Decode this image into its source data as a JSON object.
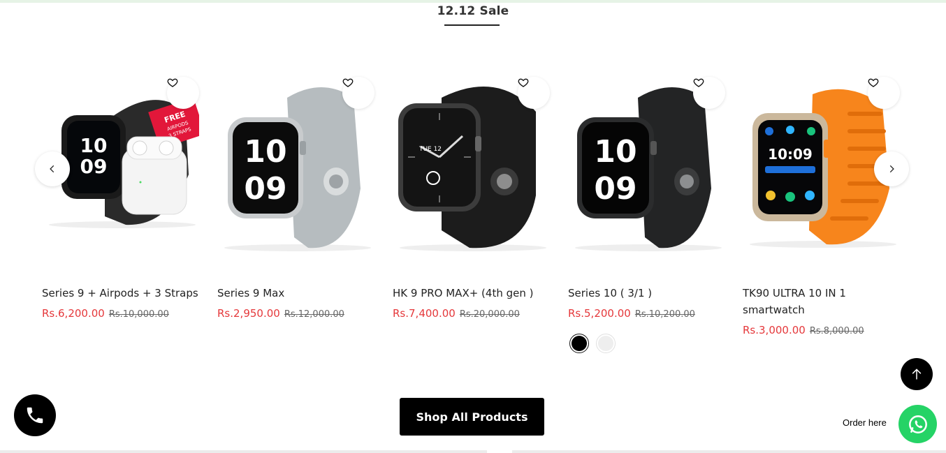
{
  "section": {
    "title": "12.12 Sale"
  },
  "products": [
    {
      "name": "Series 9 + Airpods + 3 Straps",
      "sale_price": "Rs.6,200.00",
      "old_price": "Rs.10,000.00",
      "strap_color": "#2a2a2a",
      "badge": "FREE AIRPODS 3 STRAPS"
    },
    {
      "name": "Series 9 Max",
      "sale_price": "Rs.2,950.00",
      "old_price": "Rs.12,000.00",
      "strap_color": "#aeb4b7"
    },
    {
      "name": "HK 9 PRO MAX+ (4th gen )",
      "sale_price": "Rs.7,400.00",
      "old_price": "Rs.20,000.00",
      "strap_color": "#1c1c1c",
      "screen_text": "TUE 12"
    },
    {
      "name": "Series 10 ( 3/1 )",
      "sale_price": "Rs.5,200.00",
      "old_price": "Rs.10,200.00",
      "strap_color": "#1f2021",
      "swatches": [
        "#000000",
        "#eeeeee"
      ]
    },
    {
      "name": "TK90 ULTRA 10 IN 1 smartwatch",
      "sale_price": "Rs.3,000.00",
      "old_price": "Rs.8,000.00",
      "strap_color": "#f7851c",
      "screen_text": "10:09"
    }
  ],
  "watch_time": {
    "hour": "10",
    "minute": "09"
  },
  "cta": {
    "shop_all": "Shop All Products"
  },
  "floating": {
    "order_here": "Order here"
  },
  "icons": {
    "wishlist": "heart-icon",
    "prev": "chevron-left-icon",
    "next": "chevron-right-icon",
    "phone": "phone-icon",
    "scroll_top": "arrow-up-icon",
    "whatsapp": "whatsapp-icon"
  },
  "colors": {
    "sale": "#e5383b",
    "whatsapp": "#25d366",
    "button": "#000000"
  }
}
